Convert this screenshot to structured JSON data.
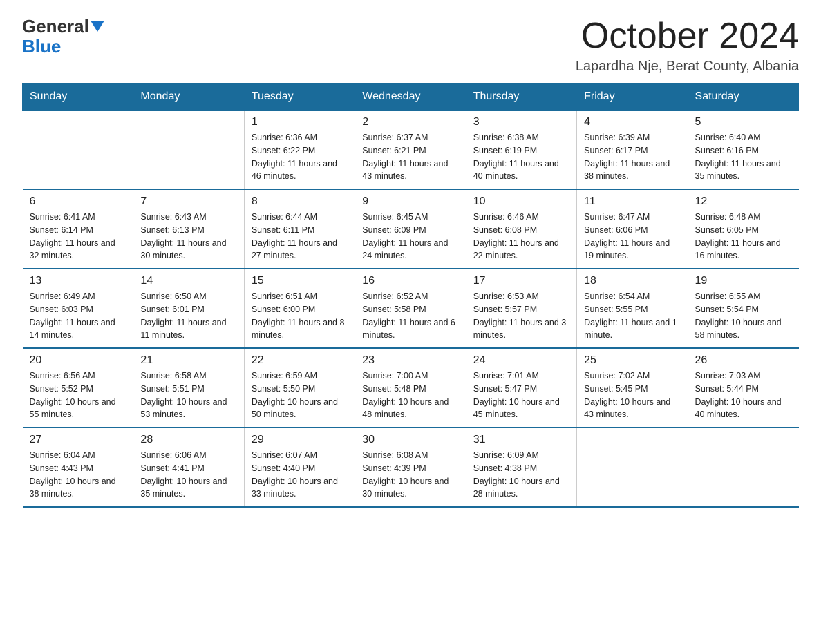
{
  "logo": {
    "general": "General",
    "blue": "Blue"
  },
  "title": "October 2024",
  "subtitle": "Lapardha Nje, Berat County, Albania",
  "days_of_week": [
    "Sunday",
    "Monday",
    "Tuesday",
    "Wednesday",
    "Thursday",
    "Friday",
    "Saturday"
  ],
  "weeks": [
    [
      {
        "day": "",
        "sunrise": "",
        "sunset": "",
        "daylight": ""
      },
      {
        "day": "",
        "sunrise": "",
        "sunset": "",
        "daylight": ""
      },
      {
        "day": "1",
        "sunrise": "Sunrise: 6:36 AM",
        "sunset": "Sunset: 6:22 PM",
        "daylight": "Daylight: 11 hours and 46 minutes."
      },
      {
        "day": "2",
        "sunrise": "Sunrise: 6:37 AM",
        "sunset": "Sunset: 6:21 PM",
        "daylight": "Daylight: 11 hours and 43 minutes."
      },
      {
        "day": "3",
        "sunrise": "Sunrise: 6:38 AM",
        "sunset": "Sunset: 6:19 PM",
        "daylight": "Daylight: 11 hours and 40 minutes."
      },
      {
        "day": "4",
        "sunrise": "Sunrise: 6:39 AM",
        "sunset": "Sunset: 6:17 PM",
        "daylight": "Daylight: 11 hours and 38 minutes."
      },
      {
        "day": "5",
        "sunrise": "Sunrise: 6:40 AM",
        "sunset": "Sunset: 6:16 PM",
        "daylight": "Daylight: 11 hours and 35 minutes."
      }
    ],
    [
      {
        "day": "6",
        "sunrise": "Sunrise: 6:41 AM",
        "sunset": "Sunset: 6:14 PM",
        "daylight": "Daylight: 11 hours and 32 minutes."
      },
      {
        "day": "7",
        "sunrise": "Sunrise: 6:43 AM",
        "sunset": "Sunset: 6:13 PM",
        "daylight": "Daylight: 11 hours and 30 minutes."
      },
      {
        "day": "8",
        "sunrise": "Sunrise: 6:44 AM",
        "sunset": "Sunset: 6:11 PM",
        "daylight": "Daylight: 11 hours and 27 minutes."
      },
      {
        "day": "9",
        "sunrise": "Sunrise: 6:45 AM",
        "sunset": "Sunset: 6:09 PM",
        "daylight": "Daylight: 11 hours and 24 minutes."
      },
      {
        "day": "10",
        "sunrise": "Sunrise: 6:46 AM",
        "sunset": "Sunset: 6:08 PM",
        "daylight": "Daylight: 11 hours and 22 minutes."
      },
      {
        "day": "11",
        "sunrise": "Sunrise: 6:47 AM",
        "sunset": "Sunset: 6:06 PM",
        "daylight": "Daylight: 11 hours and 19 minutes."
      },
      {
        "day": "12",
        "sunrise": "Sunrise: 6:48 AM",
        "sunset": "Sunset: 6:05 PM",
        "daylight": "Daylight: 11 hours and 16 minutes."
      }
    ],
    [
      {
        "day": "13",
        "sunrise": "Sunrise: 6:49 AM",
        "sunset": "Sunset: 6:03 PM",
        "daylight": "Daylight: 11 hours and 14 minutes."
      },
      {
        "day": "14",
        "sunrise": "Sunrise: 6:50 AM",
        "sunset": "Sunset: 6:01 PM",
        "daylight": "Daylight: 11 hours and 11 minutes."
      },
      {
        "day": "15",
        "sunrise": "Sunrise: 6:51 AM",
        "sunset": "Sunset: 6:00 PM",
        "daylight": "Daylight: 11 hours and 8 minutes."
      },
      {
        "day": "16",
        "sunrise": "Sunrise: 6:52 AM",
        "sunset": "Sunset: 5:58 PM",
        "daylight": "Daylight: 11 hours and 6 minutes."
      },
      {
        "day": "17",
        "sunrise": "Sunrise: 6:53 AM",
        "sunset": "Sunset: 5:57 PM",
        "daylight": "Daylight: 11 hours and 3 minutes."
      },
      {
        "day": "18",
        "sunrise": "Sunrise: 6:54 AM",
        "sunset": "Sunset: 5:55 PM",
        "daylight": "Daylight: 11 hours and 1 minute."
      },
      {
        "day": "19",
        "sunrise": "Sunrise: 6:55 AM",
        "sunset": "Sunset: 5:54 PM",
        "daylight": "Daylight: 10 hours and 58 minutes."
      }
    ],
    [
      {
        "day": "20",
        "sunrise": "Sunrise: 6:56 AM",
        "sunset": "Sunset: 5:52 PM",
        "daylight": "Daylight: 10 hours and 55 minutes."
      },
      {
        "day": "21",
        "sunrise": "Sunrise: 6:58 AM",
        "sunset": "Sunset: 5:51 PM",
        "daylight": "Daylight: 10 hours and 53 minutes."
      },
      {
        "day": "22",
        "sunrise": "Sunrise: 6:59 AM",
        "sunset": "Sunset: 5:50 PM",
        "daylight": "Daylight: 10 hours and 50 minutes."
      },
      {
        "day": "23",
        "sunrise": "Sunrise: 7:00 AM",
        "sunset": "Sunset: 5:48 PM",
        "daylight": "Daylight: 10 hours and 48 minutes."
      },
      {
        "day": "24",
        "sunrise": "Sunrise: 7:01 AM",
        "sunset": "Sunset: 5:47 PM",
        "daylight": "Daylight: 10 hours and 45 minutes."
      },
      {
        "day": "25",
        "sunrise": "Sunrise: 7:02 AM",
        "sunset": "Sunset: 5:45 PM",
        "daylight": "Daylight: 10 hours and 43 minutes."
      },
      {
        "day": "26",
        "sunrise": "Sunrise: 7:03 AM",
        "sunset": "Sunset: 5:44 PM",
        "daylight": "Daylight: 10 hours and 40 minutes."
      }
    ],
    [
      {
        "day": "27",
        "sunrise": "Sunrise: 6:04 AM",
        "sunset": "Sunset: 4:43 PM",
        "daylight": "Daylight: 10 hours and 38 minutes."
      },
      {
        "day": "28",
        "sunrise": "Sunrise: 6:06 AM",
        "sunset": "Sunset: 4:41 PM",
        "daylight": "Daylight: 10 hours and 35 minutes."
      },
      {
        "day": "29",
        "sunrise": "Sunrise: 6:07 AM",
        "sunset": "Sunset: 4:40 PM",
        "daylight": "Daylight: 10 hours and 33 minutes."
      },
      {
        "day": "30",
        "sunrise": "Sunrise: 6:08 AM",
        "sunset": "Sunset: 4:39 PM",
        "daylight": "Daylight: 10 hours and 30 minutes."
      },
      {
        "day": "31",
        "sunrise": "Sunrise: 6:09 AM",
        "sunset": "Sunset: 4:38 PM",
        "daylight": "Daylight: 10 hours and 28 minutes."
      },
      {
        "day": "",
        "sunrise": "",
        "sunset": "",
        "daylight": ""
      },
      {
        "day": "",
        "sunrise": "",
        "sunset": "",
        "daylight": ""
      }
    ]
  ]
}
